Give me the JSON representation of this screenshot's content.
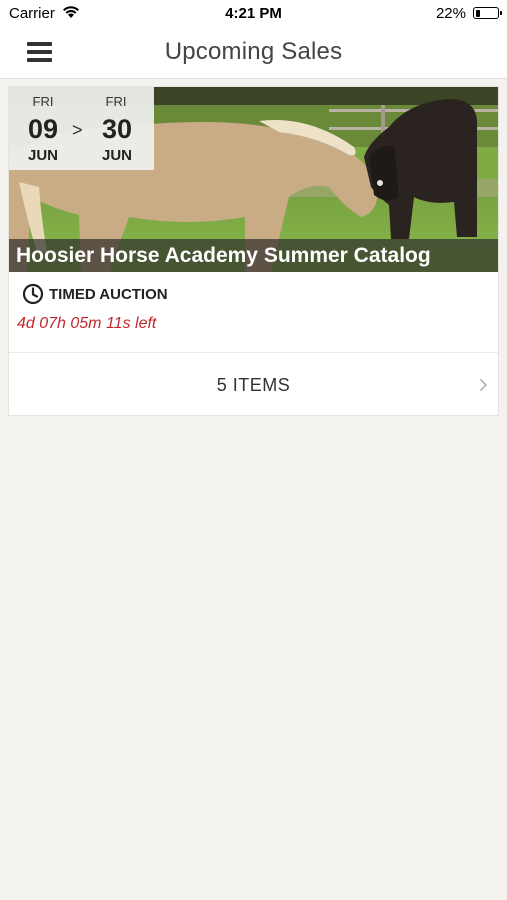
{
  "status_bar": {
    "carrier": "Carrier",
    "time": "4:21 PM",
    "battery_percent": "22%",
    "battery_level": 0.22
  },
  "nav": {
    "title": "Upcoming Sales",
    "menu_icon": "hamburger-menu-icon"
  },
  "sale": {
    "start": {
      "day": "FRI",
      "date": "09",
      "month": "JUN"
    },
    "end": {
      "day": "FRI",
      "date": "30",
      "month": "JUN"
    },
    "arrow": ">",
    "title": "Hoosier Horse Academy Summer Catalog",
    "type_label": "TIMED AUCTION",
    "type_icon": "clock-icon",
    "countdown": "4d 07h 05m 11s left",
    "items_label": "5 ITEMS",
    "items_icon": "chevron-right-icon"
  },
  "colors": {
    "background": "#f3f2ef",
    "countdown": "#c0282d",
    "banner": "#282828"
  }
}
